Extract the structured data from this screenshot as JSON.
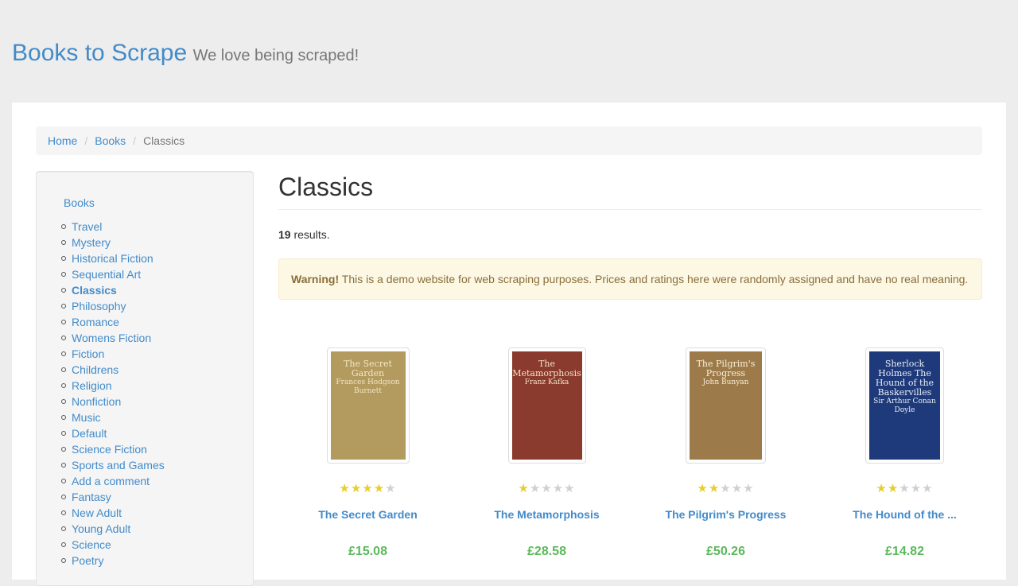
{
  "header": {
    "brand": "Books to Scrape",
    "tagline": "We love being scraped!"
  },
  "breadcrumb": {
    "home": "Home",
    "books": "Books",
    "current": "Classics"
  },
  "sidebar": {
    "root": "Books",
    "categories": [
      "Travel",
      "Mystery",
      "Historical Fiction",
      "Sequential Art",
      "Classics",
      "Philosophy",
      "Romance",
      "Womens Fiction",
      "Fiction",
      "Childrens",
      "Religion",
      "Nonfiction",
      "Music",
      "Default",
      "Science Fiction",
      "Sports and Games",
      "Add a comment",
      "Fantasy",
      "New Adult",
      "Young Adult",
      "Science",
      "Poetry"
    ],
    "current": "Classics"
  },
  "main": {
    "title": "Classics",
    "results_count": "19",
    "results_suffix": " results.",
    "alert_strong": "Warning!",
    "alert_text": " This is a demo website for web scraping purposes. Prices and ratings here were randomly assigned and have no real meaning."
  },
  "products": [
    {
      "title": "The Secret Garden",
      "price": "£15.08",
      "rating": 4,
      "cover": {
        "line1": "The Secret Garden",
        "line2": "Frances Hodgson Burnett",
        "bg": "#b39a5e",
        "fg": "#f3e7c5"
      }
    },
    {
      "title": "The Metamorphosis",
      "price": "£28.58",
      "rating": 1,
      "cover": {
        "line1": "The Metamorphosis",
        "line2": "Franz Kafka",
        "bg": "#8b3a2e",
        "fg": "#f1e4c8"
      }
    },
    {
      "title": "The Pilgrim's Progress",
      "price": "£50.26",
      "rating": 2,
      "cover": {
        "line1": "The Pilgrim's Progress",
        "line2": "John Bunyan",
        "bg": "#9c7a4a",
        "fg": "#fbf0d8"
      }
    },
    {
      "title": "The Hound of the ...",
      "price": "£14.82",
      "rating": 2,
      "cover": {
        "line1": "Sherlock Holmes The Hound of the Baskervilles",
        "line2": "Sir Arthur Conan Doyle",
        "bg": "#1f3a7a",
        "fg": "#e8eef8"
      }
    }
  ]
}
